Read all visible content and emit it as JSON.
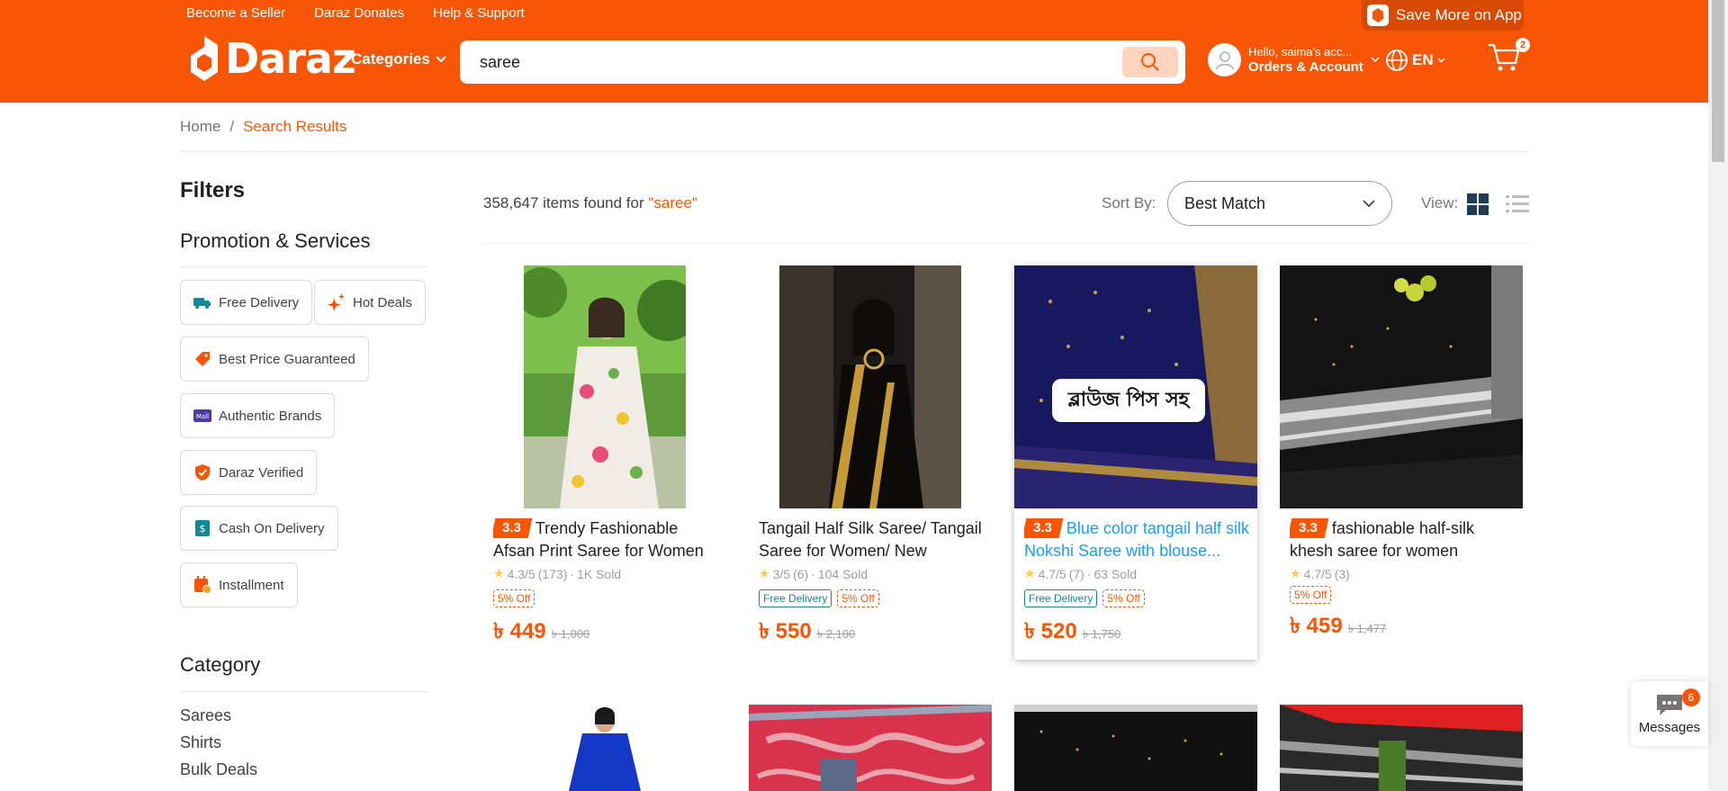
{
  "header": {
    "top_links": [
      "Become a Seller",
      "Daraz Donates",
      "Help & Support"
    ],
    "save_app": "Save More on App",
    "logo_text": "Daraz",
    "categories_label": "Categories",
    "search_value": "saree",
    "account_hello": "Hello, saima's acc...",
    "account_orders": "Orders & Account",
    "language": "EN",
    "cart_count": "2",
    "brand_color": "#f85606"
  },
  "breadcrumb": {
    "home": "Home",
    "current": "Search Results"
  },
  "filters": {
    "title": "Filters",
    "promo_title": "Promotion & Services",
    "chips": [
      {
        "label": "Free Delivery",
        "icon": "truck-icon"
      },
      {
        "label": "Hot Deals",
        "icon": "sparkle-icon"
      },
      {
        "label": "Best Price Guaranteed",
        "icon": "price-tag-icon"
      },
      {
        "label": "Authentic Brands",
        "icon": "mall-icon"
      },
      {
        "label": "Daraz Verified",
        "icon": "shield-icon"
      },
      {
        "label": "Cash On Delivery",
        "icon": "cash-icon"
      },
      {
        "label": "Installment",
        "icon": "calendar-icon"
      }
    ],
    "category_title": "Category",
    "categories": [
      "Sarees",
      "Shirts",
      "Bulk Deals"
    ]
  },
  "results": {
    "count_text": "358,647 items found for",
    "query": "\"saree\"",
    "sort_label": "Sort By:",
    "sort_value": "Best Match",
    "view_label": "View:"
  },
  "products": [
    {
      "promo": "3.3",
      "title": "Trendy Fashionable Afsan Print Saree for Women",
      "rating": "4.3/5",
      "reviews": "(173)",
      "sold": "1K Sold",
      "free_delivery": "",
      "discount": "5% Off",
      "price": "৳ 449",
      "old_price": "৳ 1,000"
    },
    {
      "promo": "",
      "title": "Tangail Half Silk Saree/ Tangail Saree for Women/ New Tangai...",
      "rating": "3/5",
      "reviews": "(6)",
      "sold": "104 Sold",
      "free_delivery": "Free Delivery",
      "discount": "5% Off",
      "price": "৳ 550",
      "old_price": "৳ 2,100"
    },
    {
      "promo": "3.3",
      "title": "Blue color tangail half silk Nokshi Saree with blouse...",
      "rating": "4.7/5",
      "reviews": "(7)",
      "sold": "63 Sold",
      "free_delivery": "Free Delivery",
      "discount": "5% Off",
      "price": "৳ 520",
      "old_price": "৳ 1,750",
      "overlay": "ব্লাউজ পিস সহ"
    },
    {
      "promo": "3.3",
      "title": "fashionable half-silk khesh saree for women",
      "rating": "4.7/5",
      "reviews": "(3)",
      "sold": "",
      "free_delivery": "",
      "discount": "5% Off",
      "price": "৳ 459",
      "old_price": "৳ 1,477"
    }
  ],
  "messages": {
    "label": "Messages",
    "count": "6"
  }
}
